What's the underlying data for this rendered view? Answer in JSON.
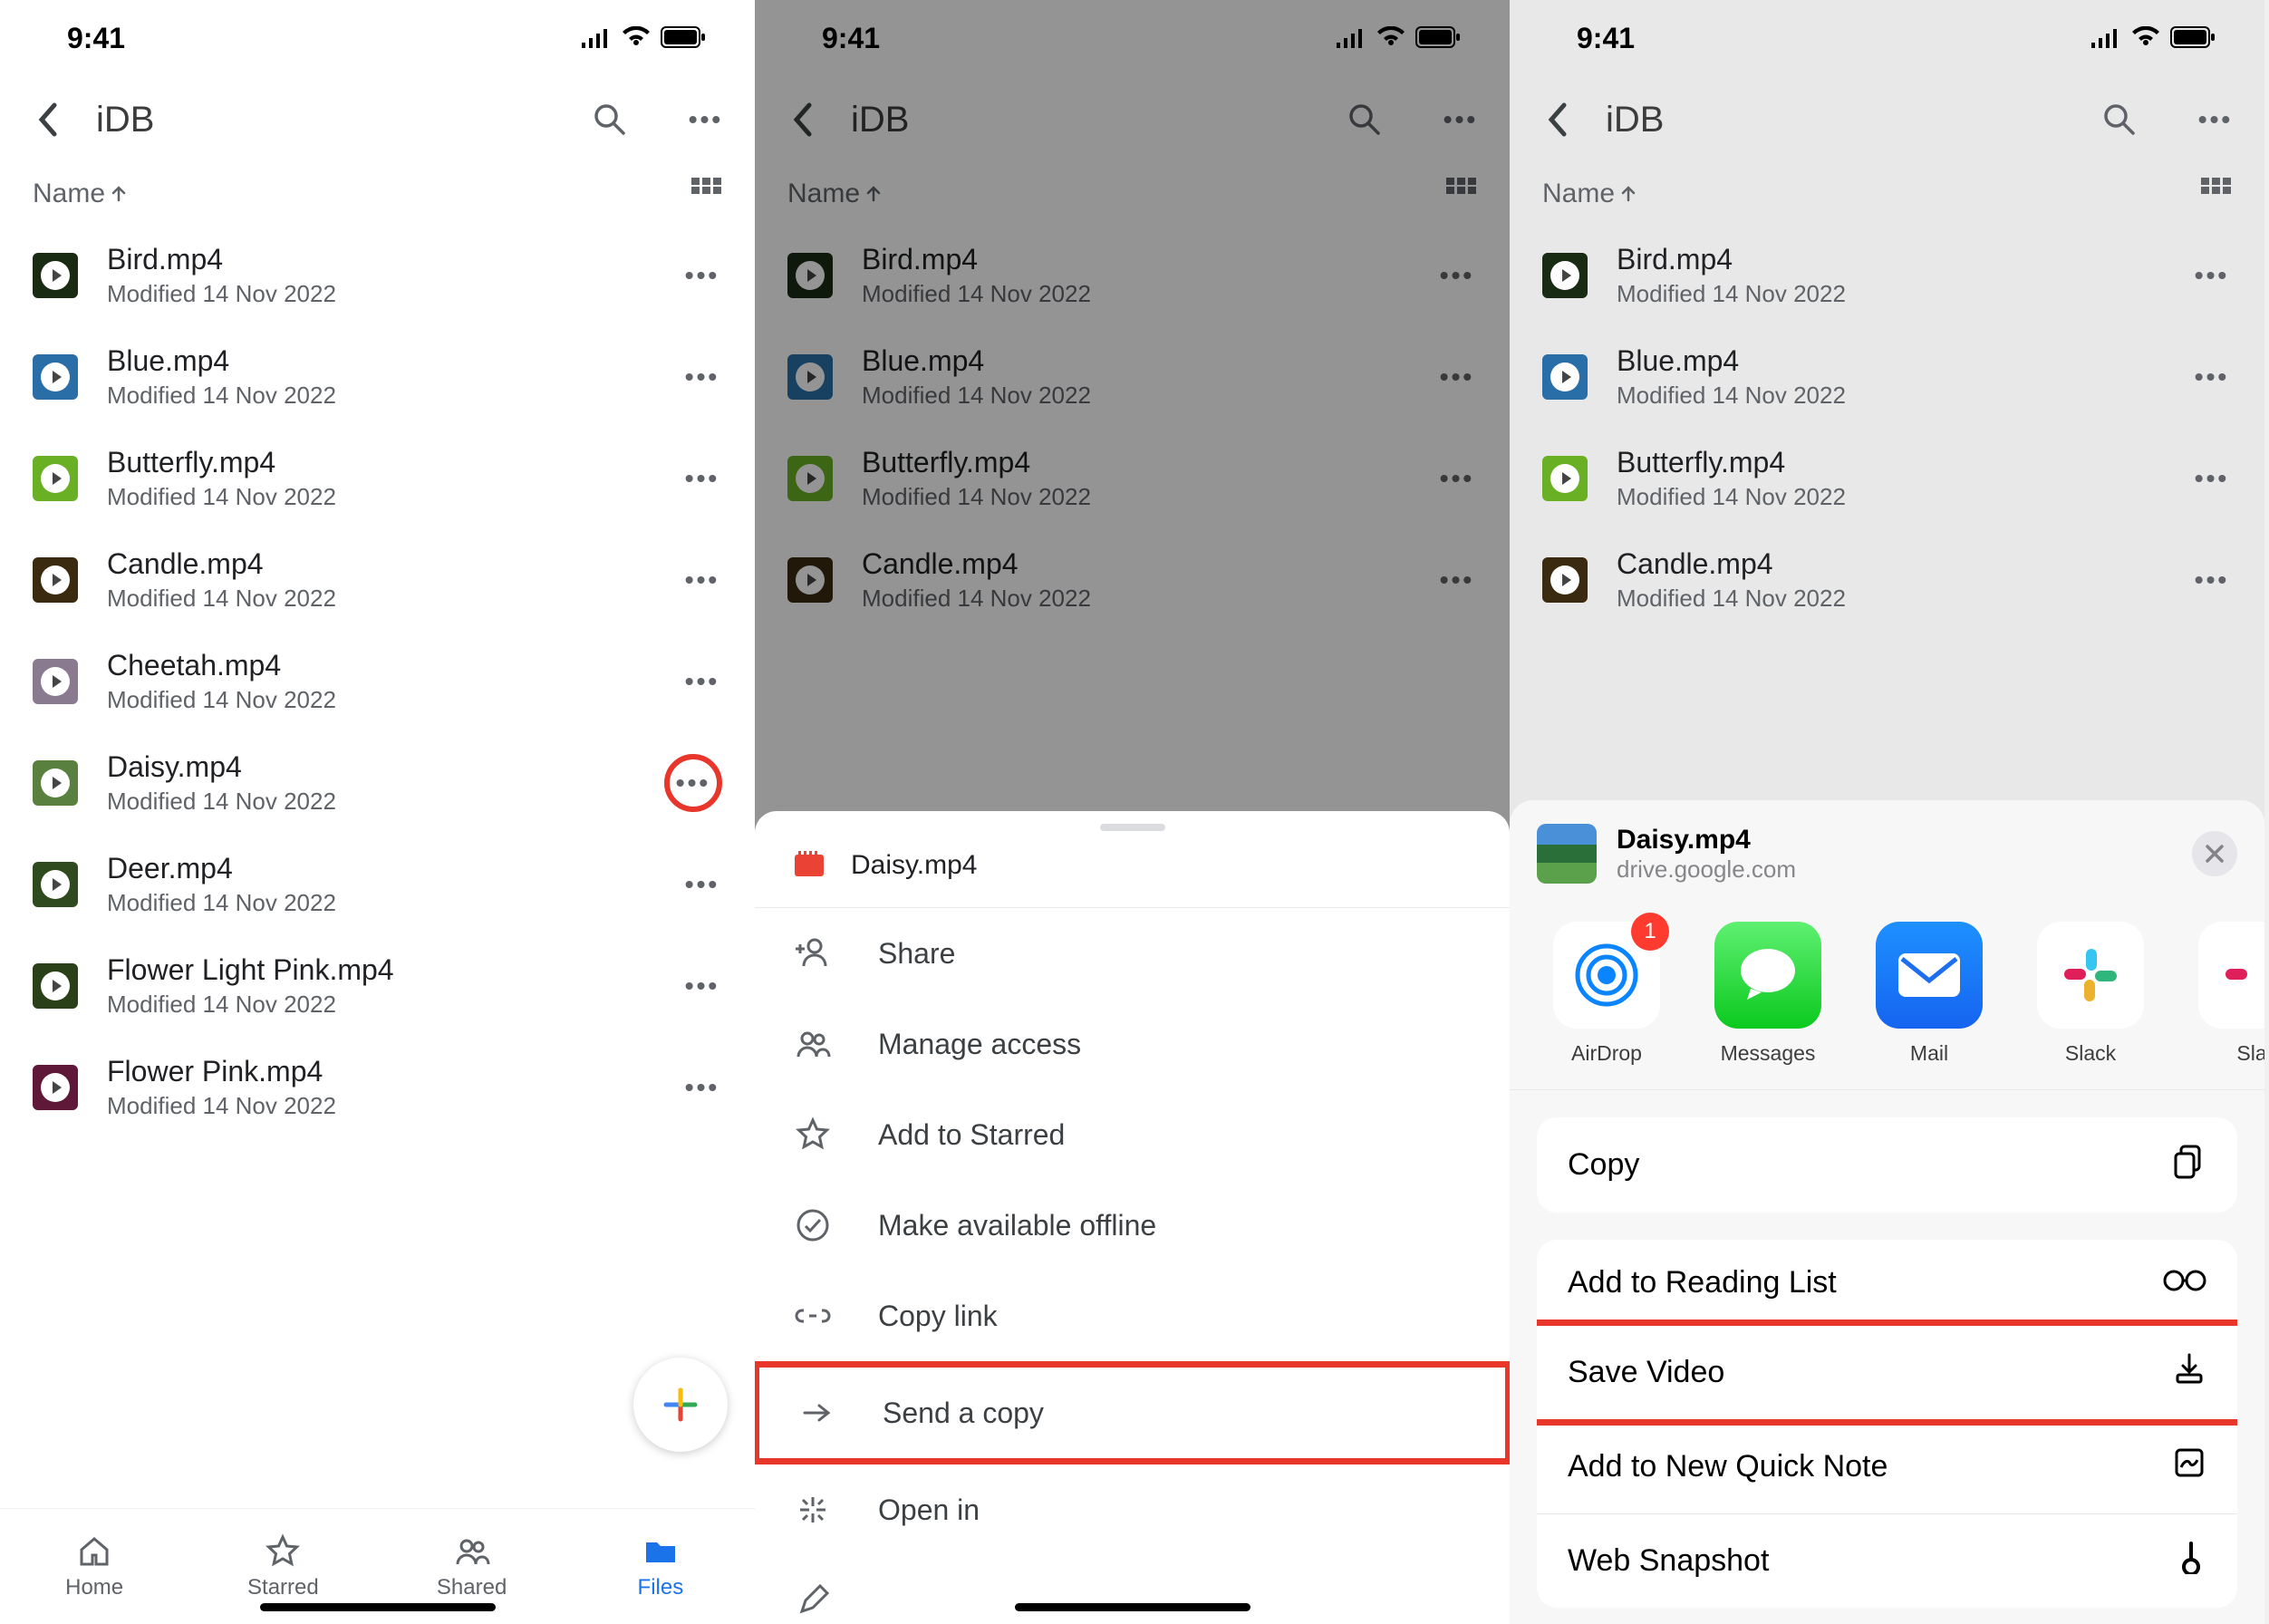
{
  "status": {
    "time": "9:41"
  },
  "header": {
    "title": "iDB"
  },
  "sort": {
    "label": "Name"
  },
  "files": [
    {
      "name": "Bird.mp4",
      "sub": "Modified 14 Nov 2022",
      "color": "#1a2b14"
    },
    {
      "name": "Blue.mp4",
      "sub": "Modified 14 Nov 2022",
      "color": "#2a6ea8"
    },
    {
      "name": "Butterfly.mp4",
      "sub": "Modified 14 Nov 2022",
      "color": "#6ab024"
    },
    {
      "name": "Candle.mp4",
      "sub": "Modified 14 Nov 2022",
      "color": "#3a2a10"
    },
    {
      "name": "Cheetah.mp4",
      "sub": "Modified 14 Nov 2022",
      "color": "#8a7a90"
    },
    {
      "name": "Daisy.mp4",
      "sub": "Modified 14 Nov 2022",
      "color": "#5a8040"
    },
    {
      "name": "Deer.mp4",
      "sub": "Modified 14 Nov 2022",
      "color": "#304a20"
    },
    {
      "name": "Flower Light Pink.mp4",
      "sub": "Modified 14 Nov 2022",
      "color": "#2a4018"
    },
    {
      "name": "Flower Pink.mp4",
      "sub": "Modified 14 Nov 2022",
      "color": "#601838"
    }
  ],
  "nav": {
    "home": "Home",
    "starred": "Starred",
    "shared": "Shared",
    "files": "Files"
  },
  "sheet": {
    "file": "Daisy.mp4",
    "share": "Share",
    "manage": "Manage access",
    "star": "Add to Starred",
    "offline": "Make available offline",
    "link": "Copy link",
    "send": "Send a copy",
    "openin": "Open in"
  },
  "ios": {
    "file": "Daisy.mp4",
    "source": "drive.google.com",
    "apps": {
      "airdrop": "AirDrop",
      "messages": "Messages",
      "mail": "Mail",
      "slack": "Slack",
      "slackcut": "Sla"
    },
    "badge": "1",
    "copy": "Copy",
    "reading": "Add to Reading List",
    "save": "Save Video",
    "quicknote": "Add to New Quick Note",
    "snapshot": "Web Snapshot"
  }
}
